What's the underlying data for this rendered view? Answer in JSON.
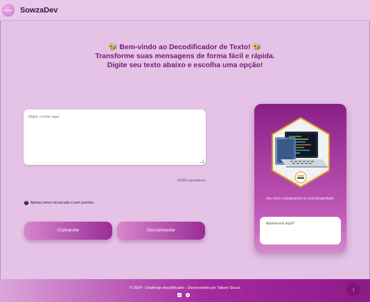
{
  "header": {
    "brand": "SowzaDev",
    "logo_icon": "brand-logo-icon"
  },
  "welcome": {
    "line1": "Bem-vindo ao Decodificador de Texto!",
    "line2": "Transforme suas mensagens de forma fácil e rápida.",
    "line3": "Digite seu texto abaixo e escolha uma opção!",
    "emoji_icon": "bee-icon"
  },
  "input": {
    "placeholder": "Digite o texto aqui",
    "value": "",
    "counter": "0/200 caracteres"
  },
  "warning": {
    "icon": "info-icon",
    "text": "Apenas letras minúsculas e sem acentos."
  },
  "buttons": {
    "encrypt": "Criptografar",
    "decrypt": "Descriptografar"
  },
  "output": {
    "message": "Seu texto criptografado ou descriptografado.",
    "placeholder": "Aparecerá aqui!!",
    "illustration_icon": "laptop-hexagon-illustration"
  },
  "footer": {
    "text": "© 2024 - Challenge decodificador - Desenvolvido por Tatiane Souza",
    "icons": [
      "linkedin-icon",
      "github-icon"
    ]
  },
  "back_to_top": {
    "icon": "arrow-up-icon",
    "glyph": "↑"
  },
  "colors": {
    "background": "#e4c3e6",
    "accent": "#7b1878",
    "button_gradient_start": "#d786cc",
    "button_gradient_end": "#9a2c97"
  }
}
